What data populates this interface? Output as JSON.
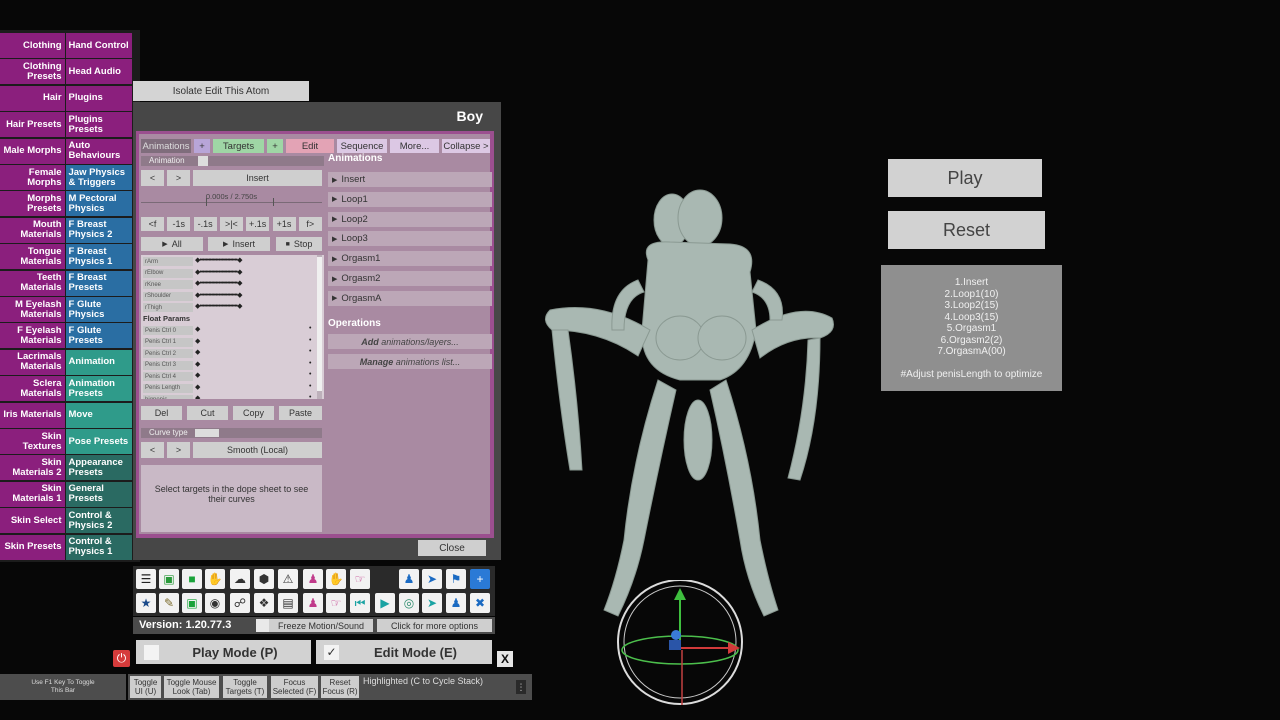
{
  "left_menu": [
    {
      "left": "Clothing",
      "right": "Hand Control",
      "lc": "#8b1f7d",
      "rc": "#8b1f7d"
    },
    {
      "left": "Clothing Presets",
      "right": "Head Audio",
      "lc": "#8b1f7d",
      "rc": "#8b1f7d"
    },
    {
      "left": "Hair",
      "right": "Plugins",
      "lc": "#8b1f7d",
      "rc": "#8b1f7d"
    },
    {
      "left": "Hair Presets",
      "right": "Plugins Presets",
      "lc": "#8b1f7d",
      "rc": "#8b1f7d"
    },
    {
      "left": "Male Morphs",
      "right": "Auto Behaviours",
      "lc": "#8b1f7d",
      "rc": "#8b1f7d"
    },
    {
      "left": "Female Morphs",
      "right": "Jaw Physics & Triggers",
      "lc": "#8b1f7d",
      "rc": "#2a6ea3"
    },
    {
      "left": "Morphs Presets",
      "right": "M Pectoral Physics",
      "lc": "#8b1f7d",
      "rc": "#2a6ea3"
    },
    {
      "left": "Mouth Materials",
      "right": "F Breast Physics 2",
      "lc": "#8b1f7d",
      "rc": "#2a6ea3"
    },
    {
      "left": "Tongue Materials",
      "right": "F Breast Physics 1",
      "lc": "#8b1f7d",
      "rc": "#2a6ea3"
    },
    {
      "left": "Teeth Materials",
      "right": "F Breast Presets",
      "lc": "#8b1f7d",
      "rc": "#2a6ea3"
    },
    {
      "left": "M Eyelash Materials",
      "right": "F Glute Physics",
      "lc": "#8b1f7d",
      "rc": "#2a6ea3"
    },
    {
      "left": "F Eyelash Materials",
      "right": "F Glute Presets",
      "lc": "#8b1f7d",
      "rc": "#2a6ea3"
    },
    {
      "left": "Lacrimals Materials",
      "right": "Animation",
      "lc": "#8b1f7d",
      "rc": "#2f9b8a"
    },
    {
      "left": "Sclera Materials",
      "right": "Animation Presets",
      "lc": "#8b1f7d",
      "rc": "#2f9b8a"
    },
    {
      "left": "Iris Materials",
      "right": "Move",
      "lc": "#8b1f7d",
      "rc": "#2f9b8a"
    },
    {
      "left": "Skin Textures",
      "right": "Pose Presets",
      "lc": "#8b1f7d",
      "rc": "#2f9b8a"
    },
    {
      "left": "Skin Materials 2",
      "right": "Appearance Presets",
      "lc": "#8b1f7d",
      "rc": "#2a6a62"
    },
    {
      "left": "Skin Materials 1",
      "right": "General Presets",
      "lc": "#8b1f7d",
      "rc": "#2a6a62"
    },
    {
      "left": "Skin Select",
      "right": "Control & Physics 2",
      "lc": "#8b1f7d",
      "rc": "#2a6a62"
    },
    {
      "left": "Skin Presets",
      "right": "Control & Physics 1",
      "lc": "#8b1f7d",
      "rc": "#2a6a62"
    }
  ],
  "isolate_button": "Isolate Edit This Atom",
  "panel_title": "Boy",
  "tabs": {
    "animations": "Animations",
    "plus1": "+",
    "targets": "Targets",
    "plus2": "+",
    "edit": "Edit",
    "sequence": "Sequence",
    "more": "More...",
    "collapse": "Collapse >"
  },
  "animation_label": "Animation",
  "nav": {
    "prev": "<",
    "next": ">",
    "insert": "Insert"
  },
  "time_display": "0.000s / 2.750s",
  "step_buttons": [
    "<f",
    "-1s",
    "-.1s",
    ">|<",
    "+.1s",
    "+1s",
    "f>"
  ],
  "play": {
    "all": "All",
    "insert": "Insert",
    "stop": "Stop"
  },
  "dope_rows": [
    "rArm",
    "rElbow",
    "rKnee",
    "rShoulder",
    "rThigh"
  ],
  "float_params_label": "Float Params",
  "float_rows": [
    "Penis Ctrl 0",
    "Penis Ctrl 1",
    "Penis Ctrl 2",
    "Penis Ctrl 3",
    "Penis Ctrl 4",
    "Penis Length",
    "bigpenis"
  ],
  "edit_buttons": {
    "del": "Del",
    "cut": "Cut",
    "copy": "Copy",
    "paste": "Paste"
  },
  "curve_type_label": "Curve type",
  "curve_value": "Smooth (Local)",
  "curve_hint": "Select targets in the dope sheet to see their curves",
  "animations_header": "Animations",
  "animations": [
    "Insert",
    "Loop1",
    "Loop2",
    "Loop3",
    "Orgasm1",
    "Orgasm2",
    "OrgasmA"
  ],
  "operations_header": "Operations",
  "operations": [
    {
      "bold": "Add",
      "rest": " animations/layers..."
    },
    {
      "bold": "Manage",
      "rest": " animations list..."
    }
  ],
  "close_button": "Close",
  "version": "Version: 1.20.77.3",
  "freeze": "Freeze Motion/Sound",
  "more_options": "Click for more options",
  "play_mode": "Play Mode (P)",
  "edit_mode": "Edit Mode (E)",
  "x_button": "X",
  "f1_hint": "Use F1 Key To Toggle This Bar",
  "bottom_buttons": [
    "Toggle UI (U)",
    "Toggle Mouse Look (Tab)",
    "Toggle Targets (T)",
    "Focus Selected (F)",
    "Reset Focus (R)"
  ],
  "highlighted_text": "Highlighted (C to Cycle Stack)",
  "scene_play": "Play",
  "scene_reset": "Reset",
  "sequence_info": [
    "1.Insert",
    "2.Loop1(10)",
    "3.Loop2(15)",
    "4.Loop3(15)",
    "5.Orgasm1",
    "6.Orgasm2(2)",
    "7.OrgasmA(00)",
    "",
    "#Adjust penisLength to optimize"
  ],
  "toolbar_icons": [
    "menu-icon",
    "scene-save-icon",
    "folder-icon",
    "hand-grab-icon",
    "cloud-download-icon",
    "package-icon",
    "alert-icon",
    "person-add-icon",
    "hand-icon",
    "pointer-hand-icon",
    "person-icon",
    "unity-icon",
    "flag-icon",
    "add-icon",
    "star-icon",
    "clean-icon",
    "camera-screenshot-icon",
    "camera-icon",
    "link-icon",
    "dropbox-icon",
    "document-icon",
    "person-remove-icon",
    "hand-drag-icon",
    "step-back-icon",
    "play-icon",
    "target-icon",
    "cursor-icon",
    "group-icon",
    "tools-icon"
  ]
}
